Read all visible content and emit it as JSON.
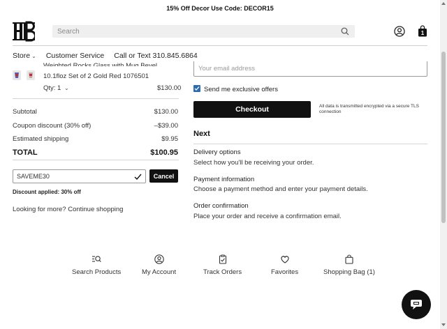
{
  "promo": {
    "text": "15% Off Decor Use Code: DECOR15"
  },
  "header": {
    "search_placeholder": "Search",
    "bag_count": "1"
  },
  "nav": {
    "items": [
      "Store",
      "Customer Service",
      "Call or Text 310.845.6864"
    ]
  },
  "cart": {
    "item": {
      "title_partial": "Weighted Rocks Glass with Mug Bevel",
      "desc": "10.1floz Set of 2 Gold Red 1076501",
      "qty_label": "Qty: 1",
      "price": "$130.00"
    },
    "rows": [
      {
        "label": "Subtotal",
        "value": "$130.00"
      },
      {
        "label": "Coupon discount (30% off)",
        "value": "–$39.00"
      },
      {
        "label": "Estimated shipping",
        "value": "$9.95"
      }
    ],
    "total_label": "TOTAL",
    "total_value": "$100.95",
    "coupon_code": "SAVEME30",
    "cancel_label": "Cancel",
    "discount_applied": "Discount applied: 30% off",
    "looking_text": "Looking for more? Continue shopping"
  },
  "checkout": {
    "email_placeholder": "Your email address",
    "offers_label": "Send me exclusive offers",
    "checkout_label": "Checkout",
    "secure_note": "All data is transmitted encrypted via a secure TLS connection",
    "next_title": "Next",
    "steps": [
      {
        "title": "Delivery options",
        "desc": "Select how you'll be receiving your order."
      },
      {
        "title": "Payment information",
        "desc": "Choose a payment method and enter your payment details."
      },
      {
        "title": "Order confirmation",
        "desc": "Place your order and receive a confirmation email."
      }
    ]
  },
  "footer_nav": [
    {
      "label": "Search Products",
      "icon": "search-list-icon"
    },
    {
      "label": "My Account",
      "icon": "account-icon"
    },
    {
      "label": "Track Orders",
      "icon": "clipboard-check-icon"
    },
    {
      "label": "Favorites",
      "icon": "heart-icon"
    },
    {
      "label": "Shopping Bag (1)",
      "icon": "shopping-bag-icon"
    }
  ],
  "colors": {
    "accent": "#111111",
    "checkbox": "#2b6cb0"
  }
}
